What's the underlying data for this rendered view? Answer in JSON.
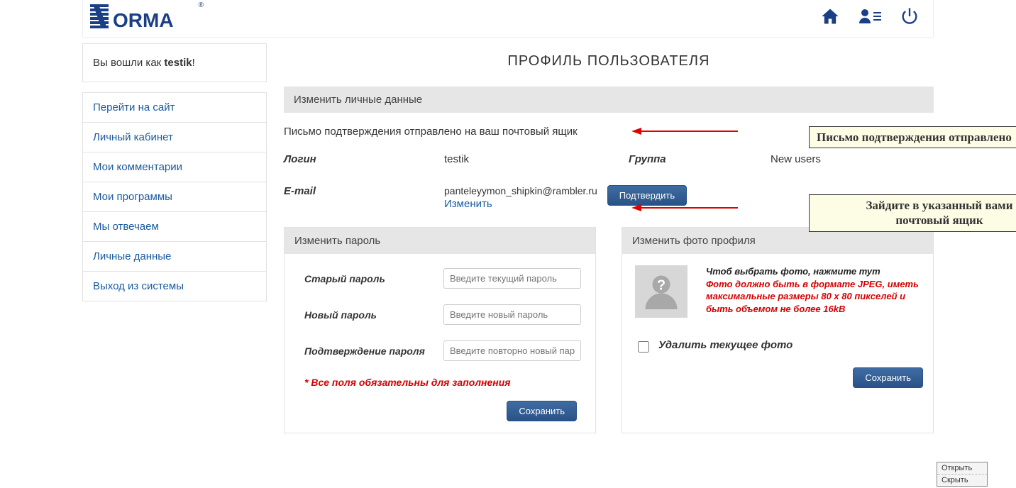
{
  "header": {
    "logo_text": "NORMA"
  },
  "sidebar": {
    "welcome_prefix": "Вы вошли как ",
    "welcome_user": "testik",
    "welcome_suffix": "!",
    "items": [
      "Перейти на сайт",
      "Личный кабинет",
      "Мои комментарии",
      "Мои программы",
      "Мы отвечаем",
      "Личные данные",
      "Выход из системы"
    ]
  },
  "main": {
    "title": "ПРОФИЛЬ ПОЛЬЗОВАТЕЛЯ",
    "personal_header": "Изменить личные данные",
    "confirm_sent": "Письмо подтверждения отправлено на ваш почтовый ящик",
    "login_label": "Логин",
    "login_value": "testik",
    "group_label": "Группа",
    "group_value": "New users",
    "email_label": "E-mail",
    "email_value": "panteleyymon_shipkin@rambler.ru",
    "change_link": "Изменить",
    "confirm_button": "Подтвердить"
  },
  "password_panel": {
    "header": "Изменить пароль",
    "old_label": "Старый пароль",
    "old_placeholder": "Введите текущий пароль",
    "new_label": "Новый пароль",
    "new_placeholder": "Введите новый пароль",
    "confirm_label": "Подтверждение пароля",
    "confirm_placeholder": "Введите повторно новый пароль",
    "required_note": "* Все поля обязательны для заполнения",
    "save_button": "Сохранить"
  },
  "photo_panel": {
    "header": "Изменить фото профиля",
    "hint_click": "Чтоб выбрать фото, нажмите тут",
    "hint_format": "Фото должно быть в формате JPEG, иметь максимальные размеры 80 х 80 пикселей и быть объемом не более 16kB",
    "delete_label": "Удалить текущее фото",
    "save_button": "Сохранить"
  },
  "annotations": {
    "callout1": "Письмо подтверждения отправлено",
    "callout2_line1": "Зайдите в указанный вами",
    "callout2_line2": "почтовый ящик"
  },
  "mini_menu": {
    "open": "Открыть",
    "hide": "Скрыть"
  }
}
